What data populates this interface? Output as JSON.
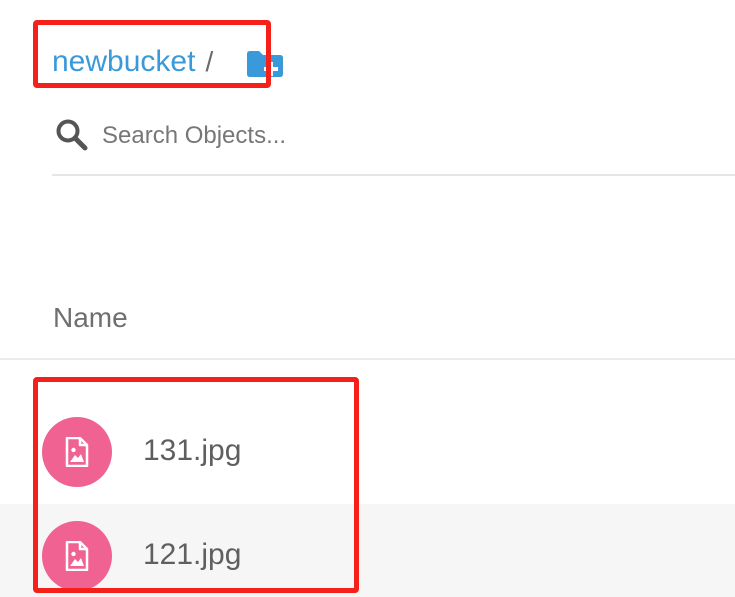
{
  "breadcrumb": {
    "bucket": "newbucket",
    "separator": "/",
    "add_folder_icon": "folder-plus-icon"
  },
  "search": {
    "placeholder": "Search Objects...",
    "value": "",
    "icon": "search-icon"
  },
  "table": {
    "columns": [
      {
        "label": "Name"
      }
    ],
    "rows": [
      {
        "name": "131.jpg",
        "icon": "image-file-icon"
      },
      {
        "name": "121.jpg",
        "icon": "image-file-icon"
      }
    ]
  },
  "colors": {
    "accent": "#3a9ad9",
    "file_icon": "#f06292",
    "highlight": "#f5201a"
  }
}
